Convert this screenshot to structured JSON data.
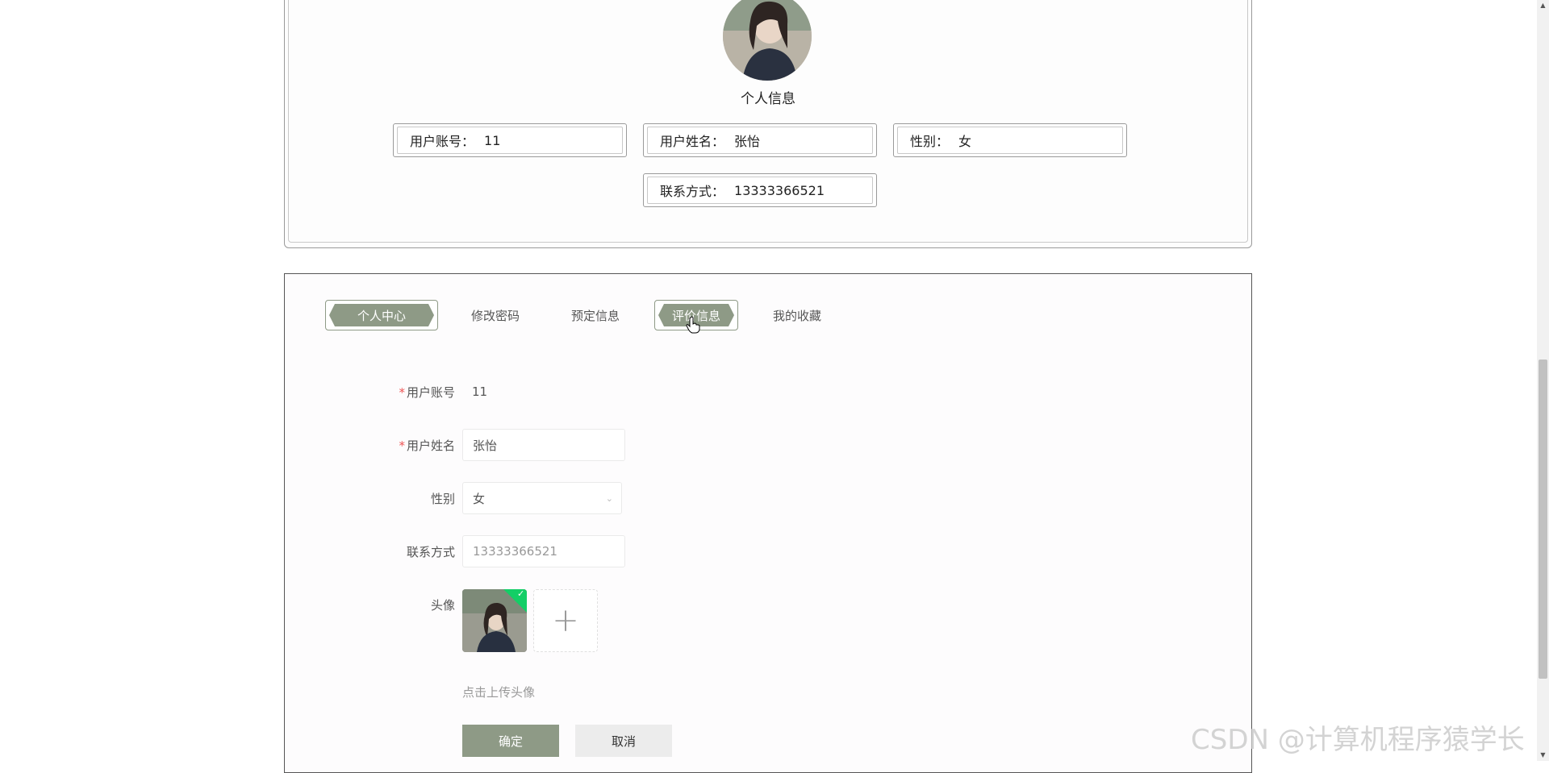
{
  "profile": {
    "title": "个人信息",
    "fields": [
      {
        "label": "用户账号：",
        "value": "11"
      },
      {
        "label": "用户姓名：",
        "value": "张怡"
      },
      {
        "label": "性别：",
        "value": "女"
      },
      {
        "label": "联系方式：",
        "value": "13333366521"
      }
    ]
  },
  "tabs": [
    {
      "label": "个人中心",
      "active": true
    },
    {
      "label": "修改密码",
      "active": false
    },
    {
      "label": "预定信息",
      "active": false
    },
    {
      "label": "评价信息",
      "active": true
    },
    {
      "label": "我的收藏",
      "active": false
    }
  ],
  "form": {
    "account": {
      "label": "用户账号",
      "value": "11",
      "required": "*"
    },
    "name": {
      "label": "用户姓名",
      "value": "张怡",
      "required": "*"
    },
    "gender": {
      "label": "性别",
      "value": "女"
    },
    "phone": {
      "label": "联系方式",
      "placeholder": "13333366521"
    },
    "avatar": {
      "label": "头像",
      "hint": "点击上传头像"
    }
  },
  "buttons": {
    "confirm": "确定",
    "cancel": "取消"
  },
  "watermark": "CSDN @计算机程序猿学长",
  "colors": {
    "accent": "#8e9a86",
    "success": "#13ce66"
  }
}
